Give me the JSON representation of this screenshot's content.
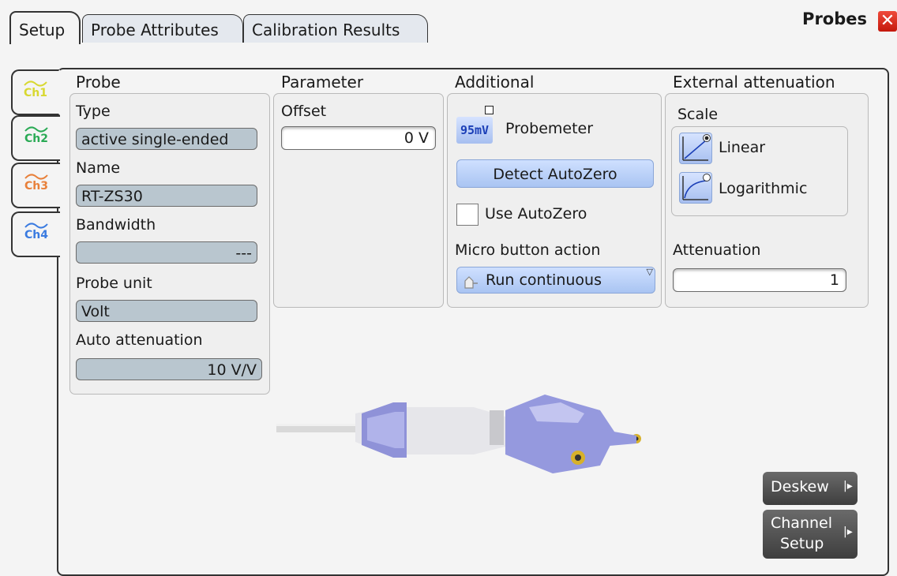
{
  "dialog": {
    "title": "Probes",
    "close_icon": "close-icon"
  },
  "tabs": [
    "Setup",
    "Probe Attributes",
    "Calibration Results"
  ],
  "channels": [
    {
      "label": "Ch1",
      "color": "#d8d830"
    },
    {
      "label": "Ch2",
      "color": "#2aaa55"
    },
    {
      "label": "Ch3",
      "color": "#e8803a"
    },
    {
      "label": "Ch4",
      "color": "#3a7be0"
    }
  ],
  "probe": {
    "heading": "Probe",
    "type_label": "Type",
    "type_value": "active single-ended",
    "name_label": "Name",
    "name_value": "RT-ZS30",
    "bandwidth_label": "Bandwidth",
    "bandwidth_value": "---",
    "unit_label": "Probe unit",
    "unit_value": "Volt",
    "auto_att_label": "Auto attenuation",
    "auto_att_value": "10 V/V"
  },
  "parameter": {
    "heading": "Parameter",
    "offset_label": "Offset",
    "offset_value": "0 V"
  },
  "additional": {
    "heading": "Additional",
    "probemeter_icon_text": "95mV",
    "probemeter_label": "Probemeter",
    "detect_autozero": "Detect AutoZero",
    "use_autozero": "Use AutoZero",
    "micro_button_label": "Micro button action",
    "micro_button_value": "Run continuous"
  },
  "external": {
    "heading": "External attenuation",
    "scale_label": "Scale",
    "linear": "Linear",
    "logarithmic": "Logarithmic",
    "selected_scale": "Linear",
    "attenuation_label": "Attenuation",
    "attenuation_value": "1"
  },
  "buttons": {
    "deskew": "Deskew",
    "channel_setup_1": "Channel",
    "channel_setup_2": "Setup"
  }
}
